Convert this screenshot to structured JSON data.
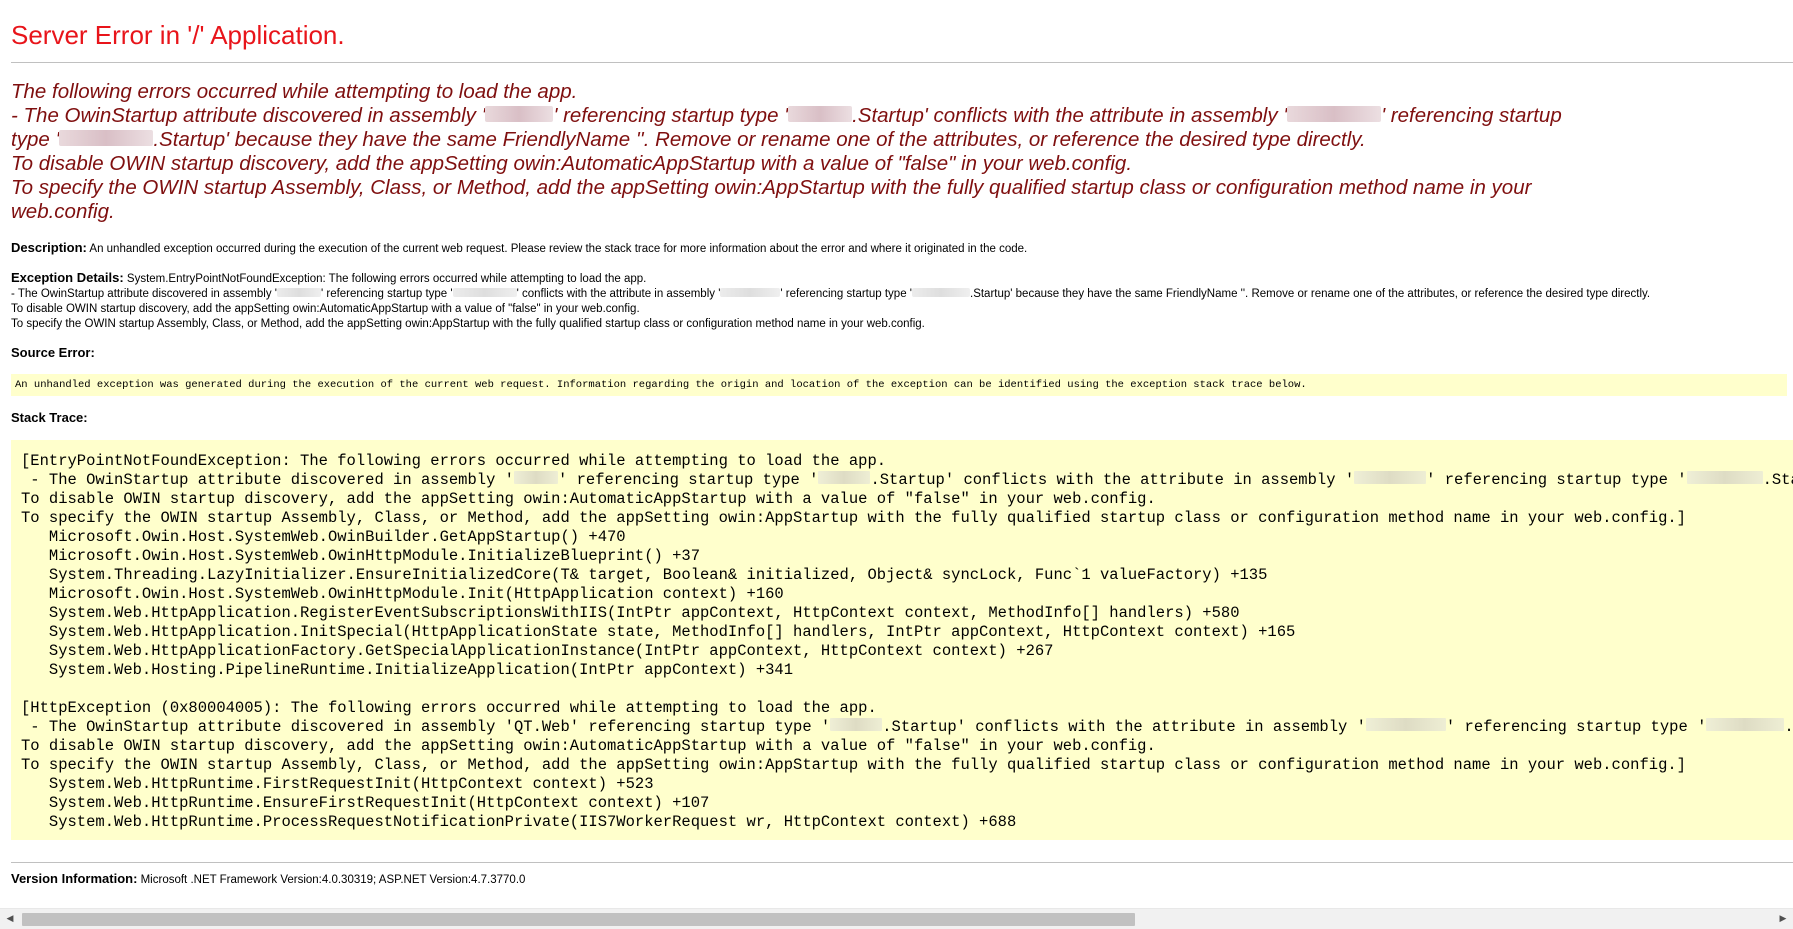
{
  "title": "Server Error in '/' Application.",
  "heading": {
    "line1": "The following errors occurred while attempting to load the app.",
    "line2_a": "- The OwinStartup attribute discovered in assembly '",
    "line2_b": "' referencing startup type '",
    "line2_c": ".Startup' conflicts with the attribute in assembly '",
    "line2_d": "' referencing startup",
    "line3_a": "type '",
    "line3_b": ".Startup' because they have the same FriendlyName ''. Remove or rename one of the attributes, or reference the desired type directly.",
    "line4": "To disable OWIN startup discovery, add the appSetting owin:AutomaticAppStartup with a value of \"false\" in your web.config.",
    "line5": "To specify the OWIN startup Assembly, Class, or Method, add the appSetting owin:AppStartup with the fully qualified startup class or configuration method name in your",
    "line6": "web.config."
  },
  "description": {
    "label": "Description:",
    "text": " An unhandled exception occurred during the execution of the current web request. Please review the stack trace for more information about the error and where it originated in the code."
  },
  "exception_details": {
    "label": "Exception Details:",
    "line1": " System.EntryPointNotFoundException: The following errors occurred while attempting to load the app.",
    "line2_a": "- The OwinStartup attribute discovered in assembly '",
    "line2_b": "' referencing startup type '",
    "line2_c": "' conflicts with the attribute in assembly '",
    "line2_d": "' referencing startup type '",
    "line2_e": ".Startup' because they have the same FriendlyName ''. Remove or rename one of the attributes, or reference the desired type directly.",
    "line3": "To disable OWIN startup discovery, add the appSetting owin:AutomaticAppStartup with a value of \"false\" in your web.config.",
    "line4": "To specify the OWIN startup Assembly, Class, or Method, add the appSetting owin:AppStartup with the fully qualified startup class or configuration method name in your web.config."
  },
  "source_error": {
    "label": "Source Error:",
    "text": "An unhandled exception was generated during the execution of the current web request. Information regarding the origin and location of the exception can be identified using the exception stack trace below."
  },
  "stack_trace": {
    "label": "Stack Trace:",
    "block1": {
      "line1": "[EntryPointNotFoundException: The following errors occurred while attempting to load the app.",
      "line2_a": " - The OwinStartup attribute discovered in assembly '",
      "line2_b": "' referencing startup type '",
      "line2_c": ".Startup' conflicts with the attribute in assembly '",
      "line2_d": "' referencing startup type '",
      "line2_e": ".Startup' beca",
      "line3": "To disable OWIN startup discovery, add the appSetting owin:AutomaticAppStartup with a value of \"false\" in your web.config.",
      "line4": "To specify the OWIN startup Assembly, Class, or Method, add the appSetting owin:AppStartup with the fully qualified startup class or configuration method name in your web.config.]",
      "frames": [
        "   Microsoft.Owin.Host.SystemWeb.OwinBuilder.GetAppStartup() +470",
        "   Microsoft.Owin.Host.SystemWeb.OwinHttpModule.InitializeBlueprint() +37",
        "   System.Threading.LazyInitializer.EnsureInitializedCore(T& target, Boolean& initialized, Object& syncLock, Func`1 valueFactory) +135",
        "   Microsoft.Owin.Host.SystemWeb.OwinHttpModule.Init(HttpApplication context) +160",
        "   System.Web.HttpApplication.RegisterEventSubscriptionsWithIIS(IntPtr appContext, HttpContext context, MethodInfo[] handlers) +580",
        "   System.Web.HttpApplication.InitSpecial(HttpApplicationState state, MethodInfo[] handlers, IntPtr appContext, HttpContext context) +165",
        "   System.Web.HttpApplicationFactory.GetSpecialApplicationInstance(IntPtr appContext, HttpContext context) +267",
        "   System.Web.Hosting.PipelineRuntime.InitializeApplication(IntPtr appContext) +341"
      ]
    },
    "block2": {
      "line1": "[HttpException (0x80004005): The following errors occurred while attempting to load the app.",
      "line2_a": " - The OwinStartup attribute discovered in assembly 'QT.Web' referencing startup type '",
      "line2_b": ".Startup' conflicts with the attribute in assembly '",
      "line2_c": "' referencing startup type '",
      "line2_d": ".Startup' beca",
      "line3": "To disable OWIN startup discovery, add the appSetting owin:AutomaticAppStartup with a value of \"false\" in your web.config.",
      "line4": "To specify the OWIN startup Assembly, Class, or Method, add the appSetting owin:AppStartup with the fully qualified startup class or configuration method name in your web.config.]",
      "frames": [
        "   System.Web.HttpRuntime.FirstRequestInit(HttpContext context) +523",
        "   System.Web.HttpRuntime.EnsureFirstRequestInit(HttpContext context) +107",
        "   System.Web.HttpRuntime.ProcessRequestNotificationPrivate(IIS7WorkerRequest wr, HttpContext context) +688"
      ]
    }
  },
  "version": {
    "label": "Version Information:",
    "text": " Microsoft .NET Framework Version:4.0.30319; ASP.NET Version:4.7.3770.0"
  },
  "scrollbar": {
    "left_arrow": "◀",
    "right_arrow": "▶"
  },
  "colors": {
    "title": "#e8141a",
    "heading": "#7f0f0f",
    "code_background": "#ffffcc"
  }
}
